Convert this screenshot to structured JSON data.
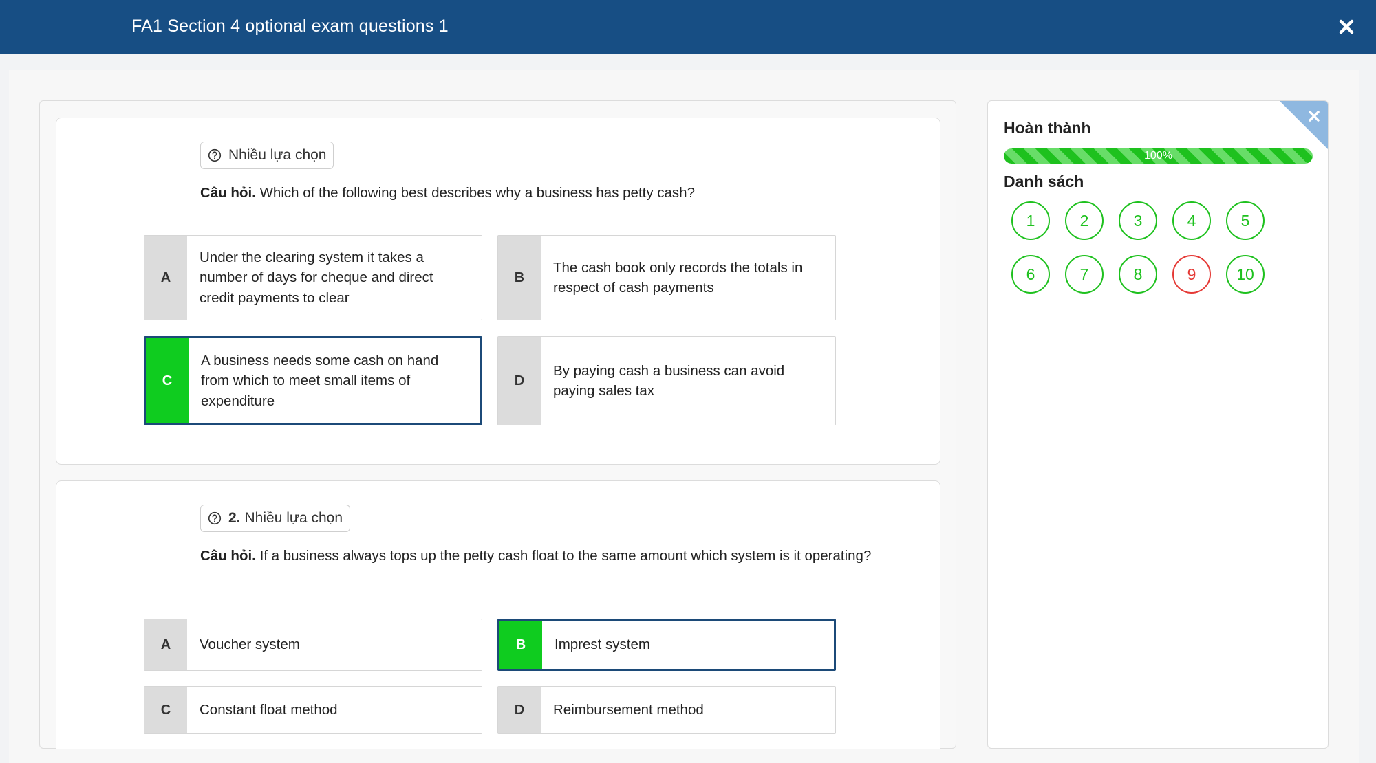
{
  "header": {
    "title": "FA1 Section 4 optional exam questions 1"
  },
  "questions": [
    {
      "type_label": "Nhiều lựa chọn",
      "prefix": "",
      "q_label": "Câu hỏi.",
      "text": "Which of the following best describes why a business has petty cash?",
      "options": [
        {
          "letter": "A",
          "text": "Under the clearing system it takes a number of days for cheque and direct credit payments to clear",
          "selected": false
        },
        {
          "letter": "B",
          "text": "The cash book only records the totals in respect of cash payments",
          "selected": false
        },
        {
          "letter": "C",
          "text": "A business needs some cash on hand from which to meet small items of expenditure",
          "selected": true
        },
        {
          "letter": "D",
          "text": "By paying cash a business can avoid paying sales tax",
          "selected": false
        }
      ]
    },
    {
      "type_label": "Nhiều lựa chọn",
      "prefix": "2.",
      "q_label": "Câu hỏi.",
      "text": "If a business always tops up the petty cash float to the same amount which system is it operating?",
      "options": [
        {
          "letter": "A",
          "text": "Voucher system",
          "selected": false
        },
        {
          "letter": "B",
          "text": "Imprest system",
          "selected": true
        },
        {
          "letter": "C",
          "text": "Constant float method",
          "selected": false
        },
        {
          "letter": "D",
          "text": "Reimbursement method",
          "selected": false
        }
      ]
    }
  ],
  "sidebar": {
    "progress_title": "Hoàn thành",
    "progress_label": "100%",
    "progress_fraction": 1.0,
    "list_title": "Danh sách",
    "numbers": [
      {
        "n": "1",
        "status": "correct"
      },
      {
        "n": "2",
        "status": "correct"
      },
      {
        "n": "3",
        "status": "correct"
      },
      {
        "n": "4",
        "status": "correct"
      },
      {
        "n": "5",
        "status": "correct"
      },
      {
        "n": "6",
        "status": "correct"
      },
      {
        "n": "7",
        "status": "correct"
      },
      {
        "n": "8",
        "status": "correct"
      },
      {
        "n": "9",
        "status": "wrong"
      },
      {
        "n": "10",
        "status": "correct"
      }
    ]
  },
  "colors": {
    "header_bg": "#174e84",
    "correct": "#1ec11e",
    "selected_letter": "#0fcc1f",
    "selected_border": "#1c4a78",
    "wrong": "#e53935"
  },
  "icons": {
    "close": "close-icon",
    "question_type": "question-circle-icon",
    "panel_close": "close-icon"
  }
}
